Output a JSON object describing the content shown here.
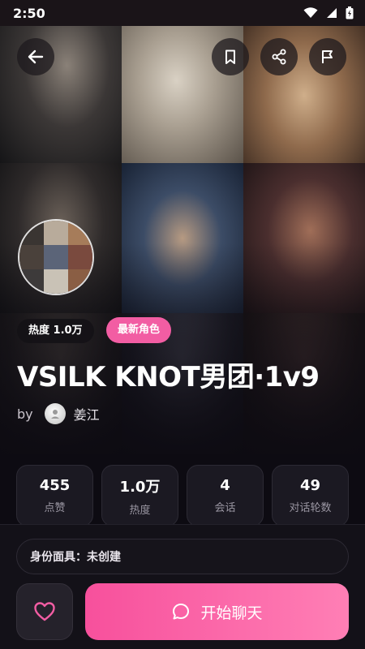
{
  "status_bar": {
    "time": "2:50"
  },
  "character": {
    "heat_badge": "热度 1.0万",
    "new_badge": "最新角色",
    "title": "VSILK KNOT男团·1v9",
    "by_label": "by",
    "author_name": "姜江"
  },
  "stats": [
    {
      "value": "455",
      "label": "点赞"
    },
    {
      "value": "1.0万",
      "label": "热度"
    },
    {
      "value": "4",
      "label": "会话"
    },
    {
      "value": "49",
      "label": "对话轮数"
    }
  ],
  "bottom": {
    "identity_mask": "身份面具：未创建",
    "start_chat": "开始聊天"
  },
  "icons": {
    "back": "arrow-left-icon",
    "bookmark": "bookmark-icon",
    "share": "share-icon",
    "report": "flag-icon",
    "like": "heart-icon",
    "chat": "chat-bubble-icon"
  },
  "colors": {
    "accent_pink": "#f25da3",
    "button_gradient_start": "#f7509c",
    "button_gradient_end": "#ff7fb5",
    "background": "#0d0b12"
  }
}
